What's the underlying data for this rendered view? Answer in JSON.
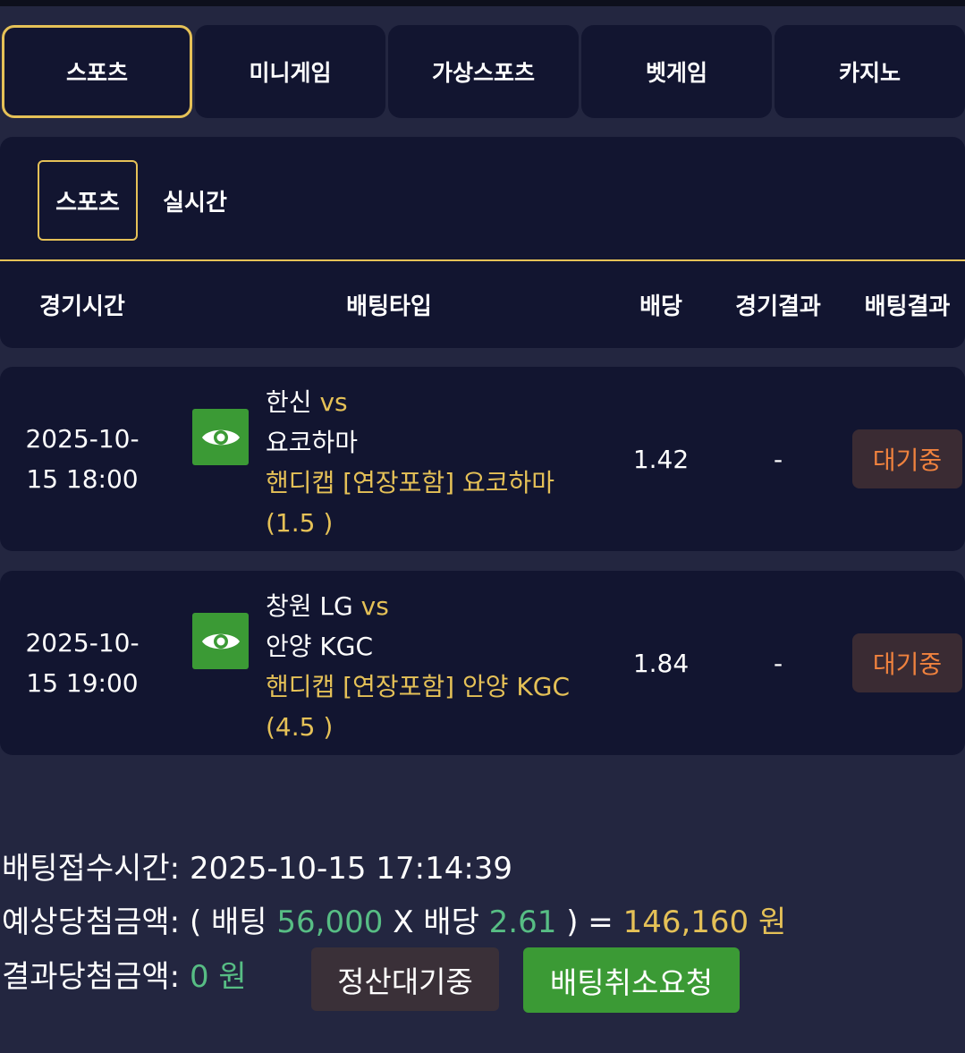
{
  "main_tabs": [
    {
      "label": "스포츠",
      "active": true
    },
    {
      "label": "미니게임",
      "active": false
    },
    {
      "label": "가상스포츠",
      "active": false
    },
    {
      "label": "벳게임",
      "active": false
    },
    {
      "label": "카지노",
      "active": false
    }
  ],
  "sub_tabs": [
    {
      "label": "스포츠",
      "active": true
    },
    {
      "label": "실시간",
      "active": false
    }
  ],
  "table": {
    "headers": {
      "time": "경기시간",
      "bet_type": "배팅타입",
      "odds": "배당",
      "game_result": "경기결과",
      "bet_result": "배팅결과"
    },
    "rows": [
      {
        "time": "2025-10-15 18:00",
        "home": "한신",
        "vs": "vs",
        "away": "요코하마",
        "market": "핸디캡 [연장포함] 요코하마 (1.5 )",
        "odds": "1.42",
        "game_result": "-",
        "bet_result": "대기중"
      },
      {
        "time": "2025-10-15 19:00",
        "home": "창원 LG",
        "vs": "vs",
        "away": "안양 KGC",
        "market": "핸디캡 [연장포함] 안양 KGC (4.5 )",
        "odds": "1.84",
        "game_result": "-",
        "bet_result": "대기중"
      }
    ]
  },
  "summary": {
    "received_label": "배팅접수시간:",
    "received_value": "2025-10-15 17:14:39",
    "expected_label": "예상당첨금액:",
    "expected_open": "( 배팅",
    "bet_amount": "56,000",
    "expected_mid": "X 배당",
    "total_odds": "2.61",
    "expected_close": ") =",
    "expected_win": "146,160 원",
    "result_label": "결과당첨금액:",
    "result_value": "0 원"
  },
  "buttons": {
    "settle_pending": "정산대기중",
    "cancel_request": "배팅취소요청"
  },
  "colors": {
    "background": "#232640",
    "panel": "#121530",
    "accent_gold": "#e5c157",
    "green_button": "#3b9a35",
    "green_text": "#57bd84",
    "pending_text": "#f0823e"
  },
  "icons": {
    "view_detail": "eye-icon"
  }
}
